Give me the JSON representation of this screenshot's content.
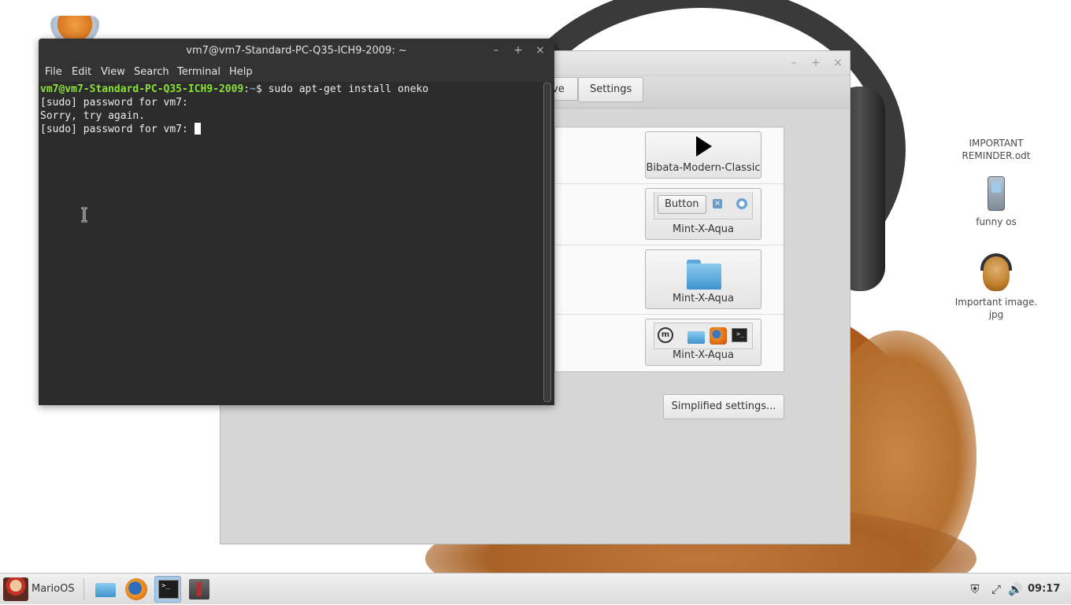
{
  "desktop": {
    "icons": [
      {
        "label": "IMPORTANT\nREMINDER.odt",
        "line1": "IMPORTANT",
        "line2": "REMINDER.odt"
      },
      {
        "label": "funny os"
      },
      {
        "label": "Important image.\njpg",
        "line1": "Important image.",
        "line2": "jpg"
      }
    ]
  },
  "themes_window": {
    "tabs": [
      "ve",
      "Settings"
    ],
    "themes": [
      {
        "name": "Bibata-Modern-Classic",
        "kind": "mouse-pointer"
      },
      {
        "name": "Mint-X-Aqua",
        "kind": "window-borders",
        "preview_button": "Button"
      },
      {
        "name": "Mint-X-Aqua",
        "kind": "icons"
      },
      {
        "name": "Mint-X-Aqua",
        "kind": "controls"
      }
    ],
    "simplified_button": "Simplified settings..."
  },
  "terminal": {
    "title": "vm7@vm7-Standard-PC-Q35-ICH9-2009: ~",
    "menu": [
      "File",
      "Edit",
      "View",
      "Search",
      "Terminal",
      "Help"
    ],
    "prompt_user": "vm7@vm7-Standard-PC-Q35-ICH9-2009",
    "prompt_sep": ":",
    "prompt_path": "~",
    "prompt_symbol": "$ ",
    "command": "sudo apt-get install oneko",
    "lines": [
      "[sudo] password for vm7:",
      "Sorry, try again.",
      "[sudo] password for vm7: "
    ],
    "window_controls": {
      "minimize": "–",
      "maximize": "+",
      "close": "×"
    }
  },
  "taskbar": {
    "menu_label": "MarioOS",
    "apps": [
      {
        "name": "files",
        "icon": "folder-icon"
      },
      {
        "name": "firefox",
        "icon": "firefox-icon"
      },
      {
        "name": "terminal",
        "icon": "terminal-icon",
        "active": true
      },
      {
        "name": "mint-update",
        "icon": "mint-icon"
      }
    ],
    "clock": "09:17"
  },
  "colors": {
    "terminal_bg": "#2c2c2c",
    "prompt_user": "#8ae234",
    "prompt_path": "#729fcf",
    "taskbar_active": "#a9c8e3"
  }
}
